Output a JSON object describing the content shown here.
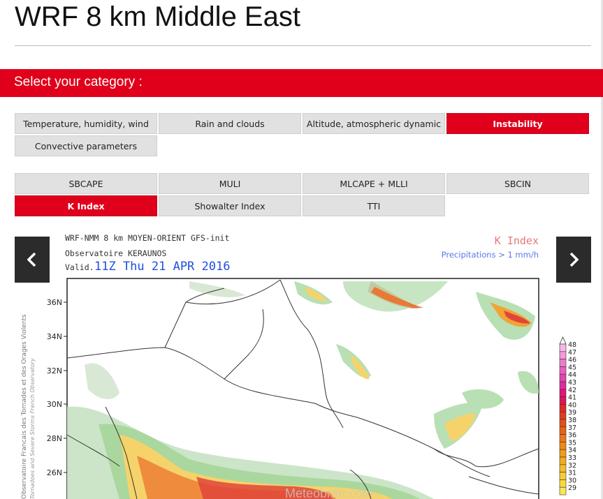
{
  "page": {
    "title": "WRF 8 km Middle East"
  },
  "category": {
    "heading": "Select your category :",
    "tabs": [
      {
        "label": "Temperature, humidity, wind",
        "active": false
      },
      {
        "label": "Rain and clouds",
        "active": false
      },
      {
        "label": "Altitude, atmospheric dynamic",
        "active": false
      },
      {
        "label": "Instability",
        "active": true
      },
      {
        "label": "Convective parameters",
        "active": false
      }
    ]
  },
  "parameters": {
    "tabs": [
      {
        "label": "SBCAPE",
        "active": false
      },
      {
        "label": "MULI",
        "active": false
      },
      {
        "label": "MLCAPE + MLLI",
        "active": false
      },
      {
        "label": "SBCIN",
        "active": false
      },
      {
        "label": "K Index",
        "active": true
      },
      {
        "label": "Showalter Index",
        "active": false
      },
      {
        "label": "TTI",
        "active": false
      }
    ]
  },
  "nav": {
    "prev_icon": "chevron-left-icon",
    "next_icon": "chevron-right-icon"
  },
  "map": {
    "line1": "WRF-NMM 8 km MOYEN-ORIENT  GFS-init",
    "line2": "Observatoire KERAUNOS",
    "valid_label": "Valid.",
    "valid_time": "11Z Thu 21 APR 2016",
    "index_title": "K Index",
    "precip_note": "Precipitations > 1 mm/h",
    "side_label_1": "Observatoire Francais des Tornades et des Orages Violents",
    "side_label_2": "Tornadoes and Severe Storms French Observatory",
    "lat_labels": [
      "36N",
      "34N",
      "32N",
      "30N",
      "28N",
      "26N"
    ],
    "legend_values": [
      "48",
      "47",
      "46",
      "45",
      "44",
      "43",
      "42",
      "41",
      "40",
      "39",
      "38",
      "37",
      "36",
      "35",
      "34",
      "33",
      "32",
      "31",
      "30",
      "29"
    ],
    "legend_colors": [
      "#f7b6e6",
      "#f39ad9",
      "#ee7ccd",
      "#e95fc0",
      "#e244b1",
      "#e02aa0",
      "#e0147e",
      "#e0145a",
      "#e02828",
      "#e33a1e",
      "#e54f1a",
      "#e86218",
      "#eb7718",
      "#ee8b18",
      "#f09d1b",
      "#f2ad20",
      "#f4bd28",
      "#f6cd33",
      "#f8da40",
      "#f9e65a"
    ],
    "watermark": "Meteobrarr.com",
    "colors": {
      "brand_red": "#e0001b",
      "alert_red": "#e8767a",
      "precip_blue": "#5a78e6",
      "valid_blue": "#1f4fe0"
    }
  }
}
